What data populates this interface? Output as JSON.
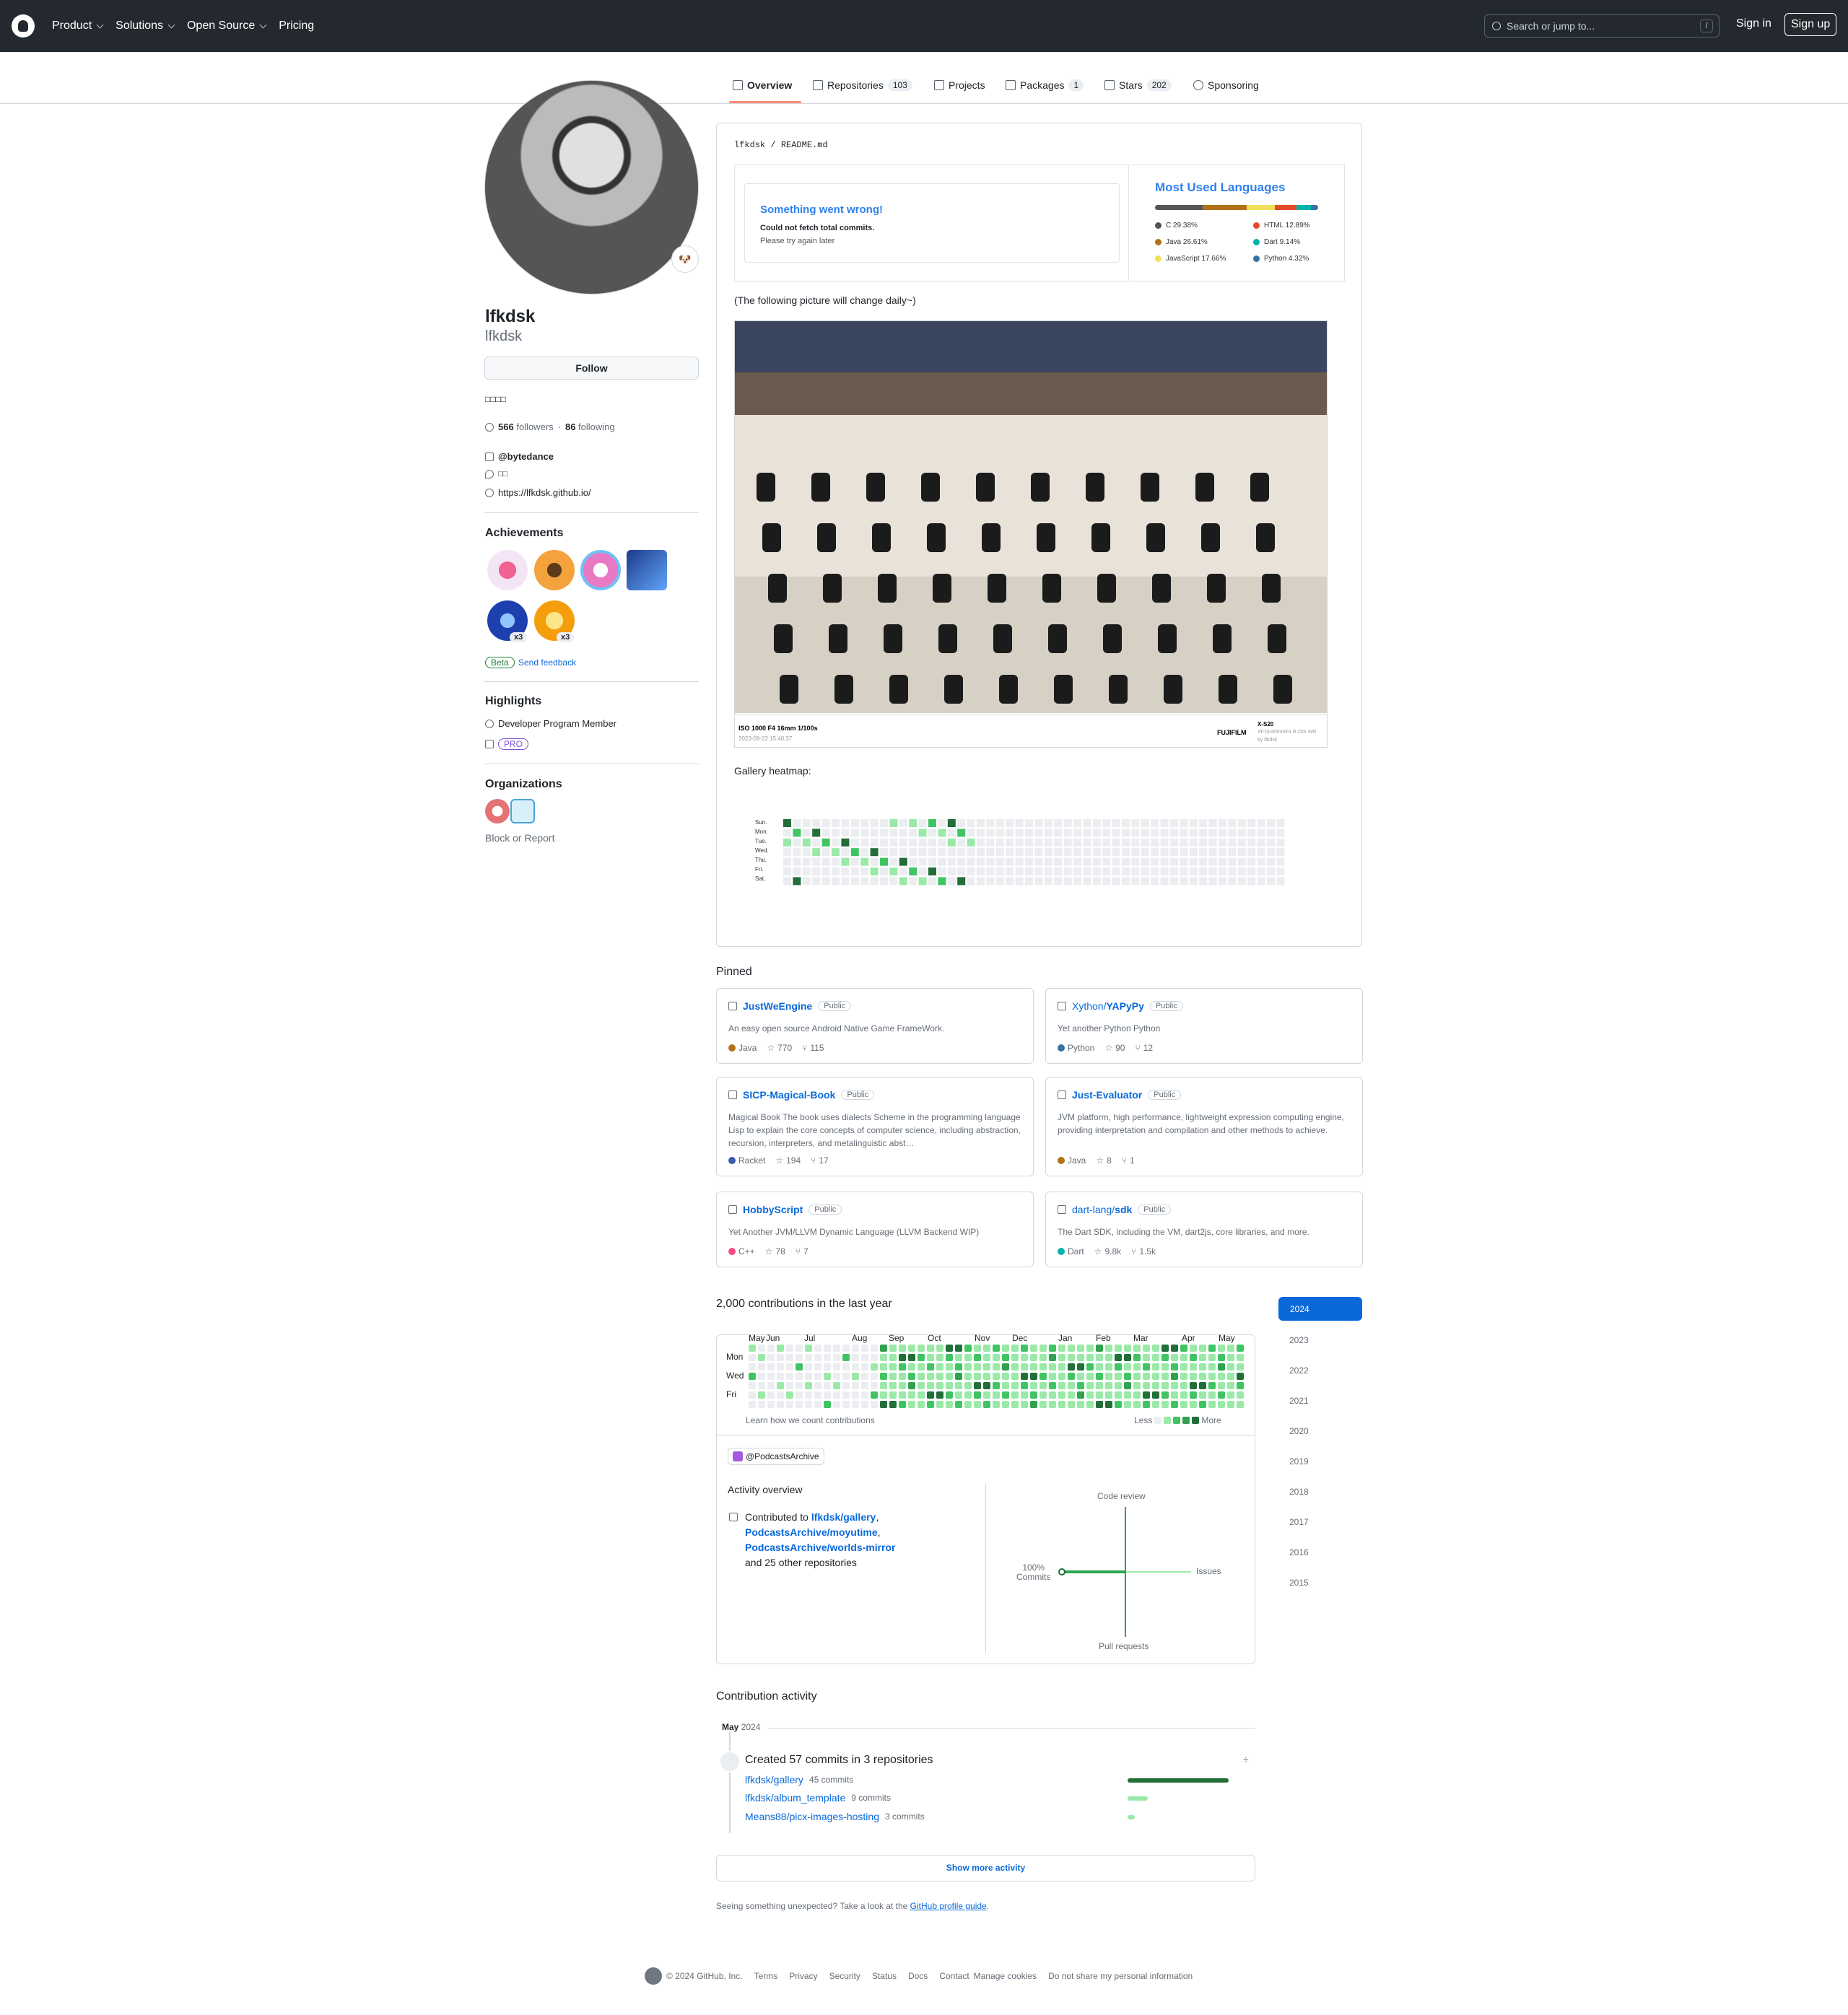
{
  "header": {
    "nav": [
      {
        "label": "Product",
        "chevron": true
      },
      {
        "label": "Solutions",
        "chevron": true
      },
      {
        "label": "Open Source",
        "chevron": true
      },
      {
        "label": "Pricing",
        "chevron": false
      }
    ],
    "search_placeholder": "Search or jump to...",
    "search_shortcut": "/",
    "sign_in": "Sign in",
    "sign_up": "Sign up"
  },
  "tabs": [
    {
      "label": "Overview",
      "count": "",
      "icon": "book-icon",
      "active": true
    },
    {
      "label": "Repositories",
      "count": "103",
      "icon": "repo-icon"
    },
    {
      "label": "Projects",
      "count": "",
      "icon": "table-icon"
    },
    {
      "label": "Packages",
      "count": "1",
      "icon": "package-icon"
    },
    {
      "label": "Stars",
      "count": "202",
      "icon": "star-icon"
    },
    {
      "label": "Sponsoring",
      "count": "",
      "icon": "heart-icon"
    }
  ],
  "profile": {
    "name": "lfkdsk",
    "login": "lfkdsk",
    "status_emoji": "🐶",
    "follow": "Follow",
    "bio": "□□□□",
    "followers_count": "566",
    "followers_label": "followers",
    "following_count": "86",
    "following_label": "following",
    "org": "@bytedance",
    "location": "□□",
    "website": "https://lfkdsk.github.io/"
  },
  "achievements": {
    "title": "Achievements",
    "badges": [
      {
        "name": "heart-on-sleeve"
      },
      {
        "name": "starstruck"
      },
      {
        "name": "yolo"
      },
      {
        "name": "arctic-code-vault"
      },
      {
        "name": "pull-shark",
        "count": "x3"
      },
      {
        "name": "quickdraw",
        "count": "x3"
      }
    ],
    "beta": "Beta",
    "feedback": "Send feedback"
  },
  "highlights": {
    "title": "Highlights",
    "program": "Developer Program Member",
    "pro": "PRO"
  },
  "organizations": {
    "title": "Organizations"
  },
  "block": "Block or Report",
  "readme": {
    "path_user": "lfkdsk",
    "path_file": "README.md",
    "error_title": "Something went wrong!",
    "error_sub": "Could not fetch total commits.",
    "error_sub2": "Please try again later",
    "mul_title": "Most Used Languages",
    "languages": [
      {
        "name": "C 29.38%",
        "pct": 29.38,
        "color": "#555555"
      },
      {
        "name": "Java 26.61%",
        "pct": 26.61,
        "color": "#b07219"
      },
      {
        "name": "JavaScript 17.66%",
        "pct": 17.66,
        "color": "#f1e05a"
      },
      {
        "name": "HTML 12.89%",
        "pct": 12.89,
        "color": "#e34c26"
      },
      {
        "name": "Dart 9.14%",
        "pct": 9.14,
        "color": "#00b4ab"
      },
      {
        "name": "Python 4.32%",
        "pct": 4.32,
        "color": "#3572a5"
      }
    ],
    "daily_caption": "(The following picture will change daily~)",
    "photo_exif": "ISO 1000 F4 16mm 1/100s",
    "photo_date": "2023-09-22 15:40:37",
    "photo_brand": "FUJIFILM",
    "photo_model": "X-S20",
    "photo_lens": "XF16-80mmF4 R OIS WR",
    "photo_by": "by lfkdsk",
    "gallery_heatmap": "Gallery heatmap:",
    "heatmap_days": [
      "Sun.",
      "Mon.",
      "Tue.",
      "Wed.",
      "Thu.",
      "Fri.",
      "Sat."
    ]
  },
  "pinned": {
    "title": "Pinned",
    "items": [
      {
        "owner": "",
        "name": "JustWeEngine",
        "badge": "Public",
        "desc": "An easy open source Android Native Game FrameWork.",
        "lang": "Java",
        "lang_color": "#b07219",
        "stars": "770",
        "forks": "115"
      },
      {
        "owner": "Xython/",
        "name": "YAPyPy",
        "badge": "Public",
        "desc": "Yet another Python Python",
        "lang": "Python",
        "lang_color": "#3572a5",
        "stars": "90",
        "forks": "12"
      },
      {
        "owner": "",
        "name": "SICP-Magical-Book",
        "badge": "Public",
        "desc": "Magical Book The book uses dialects Scheme in the programming language Lisp to explain the core concepts of computer science, including abstraction, recursion, interpreters, and metalinguistic abst…",
        "lang": "Racket",
        "lang_color": "#3c5caa",
        "stars": "194",
        "forks": "17"
      },
      {
        "owner": "",
        "name": "Just-Evaluator",
        "badge": "Public",
        "desc": "JVM platform, high performance, lightweight expression computing engine, providing interpretation and compilation and other methods to achieve.",
        "lang": "Java",
        "lang_color": "#b07219",
        "stars": "8",
        "forks": "1"
      },
      {
        "owner": "",
        "name": "HobbyScript",
        "badge": "Public",
        "desc": "Yet Another JVM/LLVM Dynamic Language (LLVM Backend WIP)",
        "lang": "C++",
        "lang_color": "#f34b7d",
        "stars": "78",
        "forks": "7"
      },
      {
        "owner": "dart-lang/",
        "name": "sdk",
        "badge": "Public",
        "desc": "The Dart SDK, including the VM, dart2js, core libraries, and more.",
        "lang": "Dart",
        "lang_color": "#00b4ab",
        "stars": "9.8k",
        "forks": "1.5k"
      }
    ]
  },
  "contributions": {
    "title": "2,000 contributions in the last year",
    "months": [
      "May",
      "Jun",
      "Jul",
      "Aug",
      "Sep",
      "Oct",
      "Nov",
      "Dec",
      "Jan",
      "Feb",
      "Mar",
      "Apr",
      "May"
    ],
    "days": [
      "Mon",
      "Wed",
      "Fri"
    ],
    "learn": "Learn how we count contributions",
    "less": "Less",
    "more": "More",
    "years": [
      "2024",
      "2023",
      "2022",
      "2021",
      "2020",
      "2019",
      "2018",
      "2017",
      "2016",
      "2015"
    ]
  },
  "activity": {
    "org": "@PodcastsArchive",
    "overview": "Activity overview",
    "contributed_to": "Contributed to",
    "repos": [
      "lfkdsk/gallery",
      "PodcastsArchive/moyutime",
      "PodcastsArchive/worlds-mirror"
    ],
    "others": "and 25 other repositories",
    "code_review": "Code review",
    "issues": "Issues",
    "pull_requests": "Pull requests",
    "commits_pct": "100%",
    "commits": "Commits",
    "commits_share": 1.0
  },
  "contribution_activity": {
    "title": "Contribution activity",
    "month": "May",
    "year": "2024",
    "summary": "Created 57 commits in 3 repositories",
    "fold": "÷",
    "rows": [
      {
        "repo": "lfkdsk/gallery",
        "commits": "45 commits",
        "value": 45
      },
      {
        "repo": "lfkdsk/album_template",
        "commits": "9 commits",
        "value": 9
      },
      {
        "repo": "Means88/picx-images-hosting",
        "commits": "3 commits",
        "value": 3
      }
    ],
    "show_more": "Show more activity"
  },
  "unexpected": {
    "text": "Seeing something unexpected? Take a look at the",
    "link": "GitHub profile guide",
    "end": "."
  },
  "footer": [
    "© 2024 GitHub, Inc.",
    "Terms",
    "Privacy",
    "Security",
    "Status",
    "Docs",
    "Contact",
    "Manage cookies",
    "Do not share my personal information"
  ]
}
